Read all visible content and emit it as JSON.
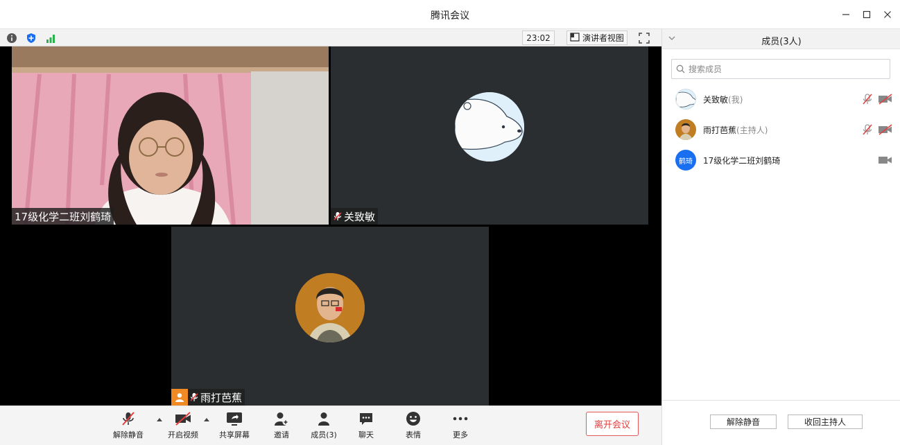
{
  "window": {
    "title": "腾讯会议"
  },
  "status": {
    "time": "23:02",
    "view_label": "演讲者视图"
  },
  "tiles": [
    {
      "name": "17级化学二班刘鹤琦",
      "muted": false
    },
    {
      "name": "关致敏",
      "muted": true
    },
    {
      "name": "雨打芭蕉",
      "muted": true,
      "is_host": true
    }
  ],
  "panel": {
    "title": "成员(3人)",
    "search_placeholder": "搜索成员",
    "members": [
      {
        "name": "关致敏",
        "role": "(我)",
        "mic_muted": true,
        "cam_off": true
      },
      {
        "name": "雨打芭蕉",
        "role": "(主持人)",
        "mic_muted": true,
        "cam_off": true
      },
      {
        "name": "17级化学二班刘鹤琦",
        "role": "",
        "avatar_text": "鹤琦",
        "mic_muted": false,
        "cam_off": false
      }
    ],
    "mute_all_label": "解除静音",
    "reclaim_host_label": "收回主持人"
  },
  "toolbar": {
    "unmute_label": "解除静音",
    "video_label": "开启视频",
    "share_label": "共享屏幕",
    "invite_label": "邀请",
    "members_label": "成员(3)",
    "chat_label": "聊天",
    "emoji_label": "表情",
    "more_label": "更多",
    "leave_label": "离开会议"
  },
  "colors": {
    "accent_blue": "#1a6ef0",
    "leave_red": "#e43b3b",
    "tile_bg": "#2b2e31",
    "host_orange": "#f08a24"
  },
  "icons": [
    "info-icon",
    "shield-icon",
    "signal-icon",
    "speaker-view-icon",
    "fullscreen-icon",
    "minimize-icon",
    "maximize-icon",
    "close-icon",
    "search-icon",
    "mic-muted-icon",
    "camera-off-icon",
    "camera-icon",
    "share-screen-icon",
    "invite-icon",
    "members-icon",
    "chat-icon",
    "emoji-icon",
    "more-icon"
  ]
}
